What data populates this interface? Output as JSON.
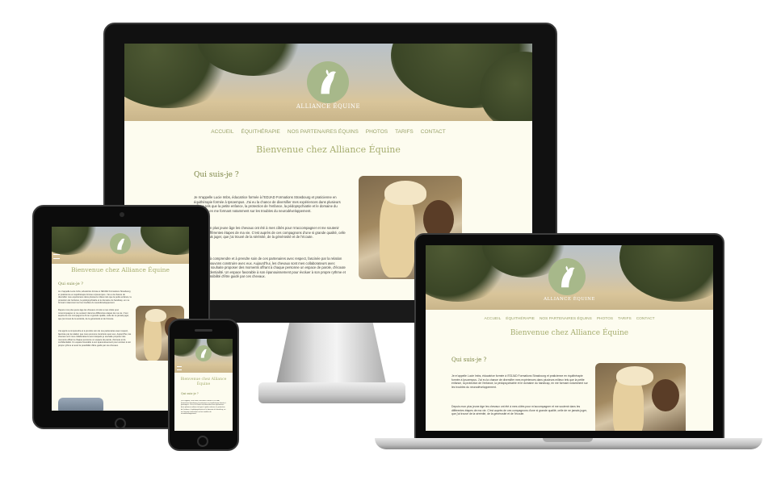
{
  "site": {
    "logo_text": "ALLIANCE ÉQUINE",
    "nav": [
      "ACCUEIL",
      "ÉQUITHÉRAPIE",
      "NOS PARTENAIRES ÉQUINS",
      "PHOTOS",
      "TARIFS",
      "CONTACT"
    ],
    "title": "Bienvenue chez Alliance Équine",
    "section_title": "Qui suis-je ?",
    "paragraph_1": "Je m'appelle Lucie Imbs, éducatrice formée à l'EDJAD Formations Strasbourg et praticienne en équithérapie formée à Ipsoempus. J'ai eu la chance de diversifier mes expériences dans plusieurs milieux tels que la petite enfance, la protection de l'enfance, la pédopsychiatrie et le domaine du handicap, en me formant notamment sur les troubles du neurodéveloppement.",
    "paragraph_2": "Depuis mon plus jeune âge les chevaux ont été à mes côtés pour m'accompagner et me soutenir dans les différentes étapes de ma vie. C'est auprès de ces compagnons d'une si grande qualité, celle de ne jamais juger, que j'ai trouvé de la sérénité, de la générosité et de l'écoute.",
    "paragraph_3": "J'ai appris à comprendre et à prendre soin de ces partenaires avec respect, fascinée par la relation que nous pouvons construire avec eux. Aujourd'hui, les chevaux sont mes collaborateurs avec lesquels je souhaite proposer des moments offrant à chaque personne un espace de parole, d'écoute et de confidentialité. Un espace favorable à son épanouissement pour évoluer à son propre rythme et avoir la possibilité d'être guidé par ces chevaux."
  },
  "colors": {
    "page_bg": "#fdfcef",
    "accent": "#a5ac6e",
    "logo": "#a7b88a",
    "device_frame": "#111111"
  },
  "icons": [
    "horse-logo-icon",
    "menu-hamburger-icon"
  ]
}
